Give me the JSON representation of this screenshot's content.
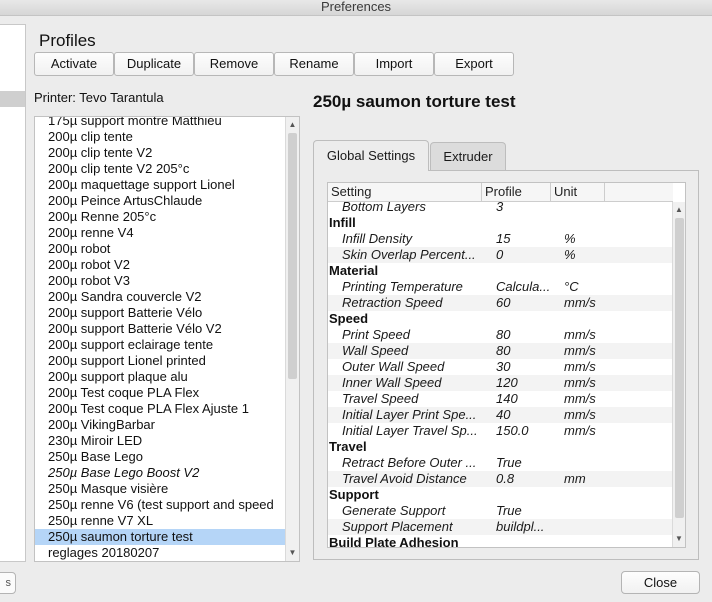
{
  "window": {
    "title": "Preferences"
  },
  "left_nav": {
    "partial_button": "s"
  },
  "profiles": {
    "heading": "Profiles",
    "buttons": [
      {
        "label": "Activate",
        "name": "activate-button"
      },
      {
        "label": "Duplicate",
        "name": "duplicate-button"
      },
      {
        "label": "Remove",
        "name": "remove-button"
      },
      {
        "label": "Rename",
        "name": "rename-button"
      },
      {
        "label": "Import",
        "name": "import-button"
      },
      {
        "label": "Export",
        "name": "export-button"
      }
    ],
    "printer_label": "Printer: Tevo Tarantula",
    "items": [
      {
        "label": "175µ support montre Matthieu"
      },
      {
        "label": "200µ clip tente"
      },
      {
        "label": "200µ clip tente V2"
      },
      {
        "label": "200µ clip tente V2 205°c"
      },
      {
        "label": "200µ maquettage support Lionel"
      },
      {
        "label": "200µ Peince ArtusChlaude"
      },
      {
        "label": "200µ Renne 205°c"
      },
      {
        "label": "200µ renne V4"
      },
      {
        "label": "200µ robot"
      },
      {
        "label": "200µ robot V2"
      },
      {
        "label": "200µ robot V3"
      },
      {
        "label": "200µ Sandra couvercle V2"
      },
      {
        "label": "200µ support Batterie Vélo"
      },
      {
        "label": "200µ support Batterie Vélo V2"
      },
      {
        "label": "200µ support eclairage tente"
      },
      {
        "label": "200µ support Lionel printed"
      },
      {
        "label": "200µ support plaque alu"
      },
      {
        "label": "200µ Test coque PLA Flex"
      },
      {
        "label": "200µ Test coque PLA Flex Ajuste 1"
      },
      {
        "label": "200µ VikingBarbar"
      },
      {
        "label": "230µ Miroir LED"
      },
      {
        "label": "250µ Base Lego"
      },
      {
        "label": "250µ Base Lego Boost V2",
        "italic": true
      },
      {
        "label": "250µ Masque visière"
      },
      {
        "label": "250µ renne V6 (test support and speed"
      },
      {
        "label": "250µ renne V7 XL"
      },
      {
        "label": "250µ saumon torture test",
        "selected": true
      },
      {
        "label": "reglages 20180207"
      }
    ],
    "selected_color": "#b5d5f7"
  },
  "details": {
    "profile_title": "250µ saumon torture test",
    "tabs": [
      {
        "label": "Global Settings",
        "active": true
      },
      {
        "label": "Extruder",
        "active": false
      }
    ],
    "table": {
      "columns": [
        "Setting",
        "Profile",
        "Unit"
      ],
      "rows": [
        {
          "type": "setting",
          "name": "Bottom Layers",
          "profile": "3",
          "unit": ""
        },
        {
          "type": "category",
          "name": "Infill"
        },
        {
          "type": "setting",
          "name": "Infill Density",
          "profile": "15",
          "unit": "%"
        },
        {
          "type": "setting",
          "name": "Skin Overlap Percent...",
          "profile": "0",
          "unit": "%"
        },
        {
          "type": "category",
          "name": "Material"
        },
        {
          "type": "setting",
          "name": "Printing Temperature",
          "profile": "Calcula...",
          "unit": "°C"
        },
        {
          "type": "setting",
          "name": "Retraction Speed",
          "profile": "60",
          "unit": "mm/s"
        },
        {
          "type": "category",
          "name": "Speed"
        },
        {
          "type": "setting",
          "name": "Print Speed",
          "profile": "80",
          "unit": "mm/s"
        },
        {
          "type": "setting",
          "name": "Wall Speed",
          "profile": "80",
          "unit": "mm/s"
        },
        {
          "type": "setting",
          "name": "Outer Wall Speed",
          "profile": "30",
          "unit": "mm/s"
        },
        {
          "type": "setting",
          "name": "Inner Wall Speed",
          "profile": "120",
          "unit": "mm/s"
        },
        {
          "type": "setting",
          "name": "Travel Speed",
          "profile": "140",
          "unit": "mm/s"
        },
        {
          "type": "setting",
          "name": "Initial Layer Print Spe...",
          "profile": "40",
          "unit": "mm/s"
        },
        {
          "type": "setting",
          "name": "Initial Layer Travel Sp...",
          "profile": "150.0",
          "unit": "mm/s"
        },
        {
          "type": "category",
          "name": "Travel"
        },
        {
          "type": "setting",
          "name": "Retract Before Outer ...",
          "profile": "True",
          "unit": ""
        },
        {
          "type": "setting",
          "name": "Travel Avoid Distance",
          "profile": "0.8",
          "unit": "mm"
        },
        {
          "type": "category",
          "name": "Support"
        },
        {
          "type": "setting",
          "name": "Generate Support",
          "profile": "True",
          "unit": ""
        },
        {
          "type": "setting",
          "name": "Support Placement",
          "profile": "buildpl...",
          "unit": ""
        },
        {
          "type": "category",
          "name": "Build Plate Adhesion"
        }
      ]
    }
  },
  "footer": {
    "close_label": "Close"
  },
  "icons": {
    "scroll_up": "▲",
    "scroll_down": "▼"
  }
}
